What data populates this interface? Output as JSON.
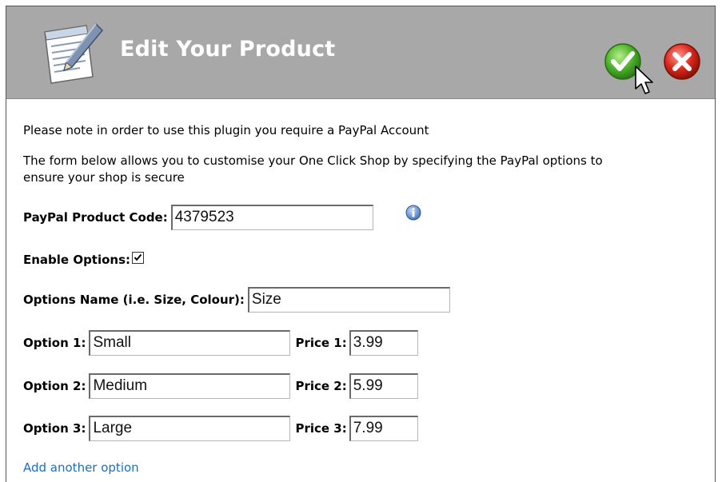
{
  "header": {
    "title": "Edit Your Product"
  },
  "icons": {
    "notepad": "notepad-pencil-icon",
    "confirm": "green-check-icon",
    "cancel": "red-x-icon",
    "info": "info-icon",
    "cursor": "mouse-pointer-icon"
  },
  "colors": {
    "header_bg": "#a8a8a8",
    "header_text": "#ffffff",
    "confirm": "#4caf2a",
    "cancel": "#d8261c",
    "link": "#1b6ec2"
  },
  "notes": {
    "line1": "Please note in order to use this plugin you require a PayPal Account",
    "line2a": "The form below allows you to customise your One Click Shop by specifying the PayPal options to",
    "line2b": "ensure your shop is secure"
  },
  "form": {
    "product_code_label": "PayPal Product Code:",
    "product_code_value": "4379523",
    "enable_options_label": "Enable Options:",
    "enable_options_checked": true,
    "options_name_label": "Options Name (i.e. Size, Colour):",
    "options_name_value": "Size",
    "options": [
      {
        "label": "Option 1:",
        "value": "Small",
        "price_label": "Price 1:",
        "price": "3.99"
      },
      {
        "label": "Option 2:",
        "value": "Medium",
        "price_label": "Price 2:",
        "price": "5.99"
      },
      {
        "label": "Option 3:",
        "value": "Large",
        "price_label": "Price 3:",
        "price": "7.99"
      }
    ],
    "add_option_link": "Add another option"
  }
}
